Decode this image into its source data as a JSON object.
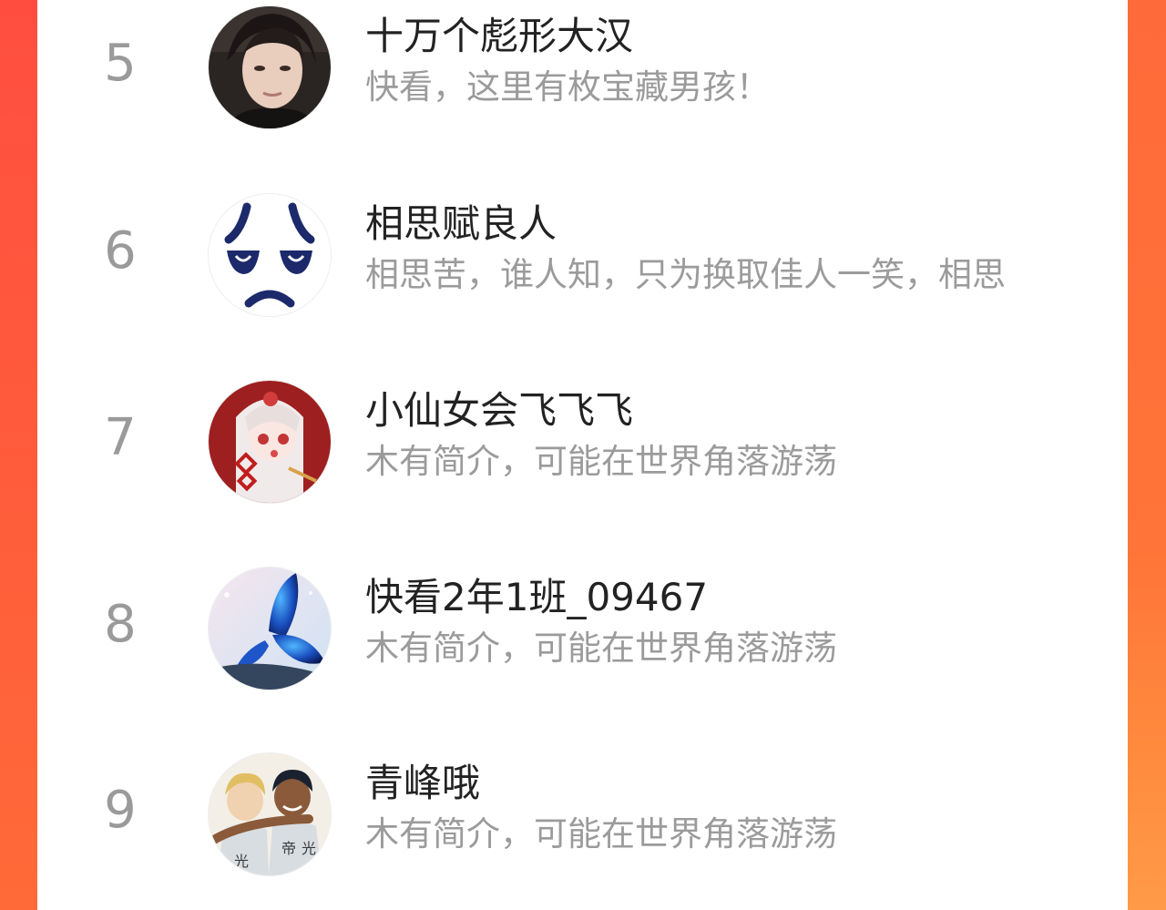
{
  "ranking": [
    {
      "rank": "5",
      "name": "十万个彪形大汉",
      "desc": "快看，这里有枚宝藏男孩！",
      "avatar_icon": "user-photo-avatar"
    },
    {
      "rank": "6",
      "name": "相思赋良人",
      "desc": "相思苦，谁人知，只为换取佳人一笑，相思",
      "avatar_icon": "sad-face-avatar"
    },
    {
      "rank": "7",
      "name": "小仙女会飞飞飞",
      "desc": "木有简介，可能在世界角落游荡",
      "avatar_icon": "anime-girl-avatar"
    },
    {
      "rank": "8",
      "name": "快看2年1班_09467",
      "desc": "木有简介，可能在世界角落游荡",
      "avatar_icon": "blue-butterfly-avatar"
    },
    {
      "rank": "9",
      "name": "青峰哦",
      "desc": "木有简介，可能在世界角落游荡",
      "avatar_icon": "basketball-players-avatar"
    }
  ],
  "colors": {
    "background_left": "#ff4e40",
    "background_right": "#ff7438",
    "card": "#ffffff",
    "rank_text": "#9a9a9a",
    "name_text": "#222222",
    "desc_text": "#9b9b9b"
  }
}
